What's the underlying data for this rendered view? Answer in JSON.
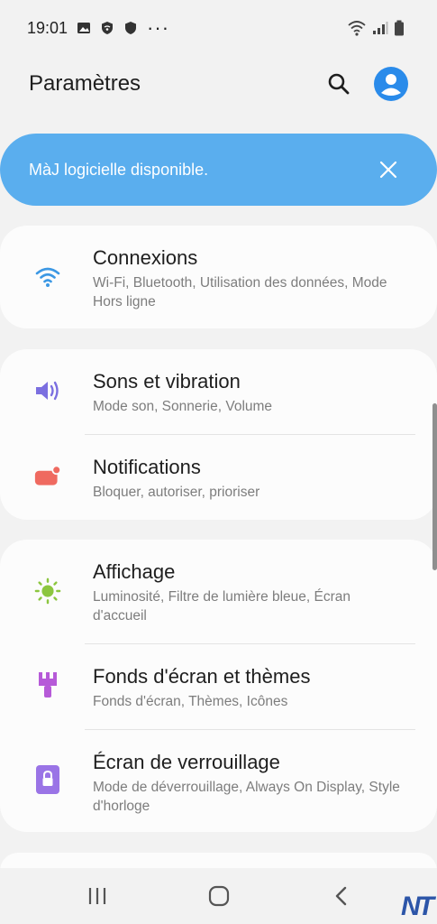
{
  "status": {
    "time": "19:01",
    "dots": "···"
  },
  "header": {
    "title": "Paramètres"
  },
  "banner": {
    "text": "MàJ logicielle disponible."
  },
  "items": [
    {
      "title": "Connexions",
      "subtitle": "Wi-Fi, Bluetooth, Utilisation des données, Mode Hors ligne",
      "icon": "wifi-icon",
      "color": "#3c98e4"
    },
    {
      "title": "Sons et vibration",
      "subtitle": "Mode son, Sonnerie, Volume",
      "icon": "volume-icon",
      "color": "#7b6fe0"
    },
    {
      "title": "Notifications",
      "subtitle": "Bloquer, autoriser, prioriser",
      "icon": "notification-icon",
      "color": "#ef6a60"
    },
    {
      "title": "Affichage",
      "subtitle": "Luminosité, Filtre de lumière bleue, Écran d'accueil",
      "icon": "brightness-icon",
      "color": "#8cc63f"
    },
    {
      "title": "Fonds d'écran et thèmes",
      "subtitle": "Fonds d'écran, Thèmes, Icônes",
      "icon": "brush-icon",
      "color": "#b65ad8"
    },
    {
      "title": "Écran de verrouillage",
      "subtitle": "Mode de déverrouillage, Always On Display, Style d'horloge",
      "icon": "lock-icon",
      "color": "#9a74e6"
    }
  ],
  "watermark": "NT",
  "colors": {
    "accent": "#5aaeee",
    "avatar": "#2a8bea"
  }
}
